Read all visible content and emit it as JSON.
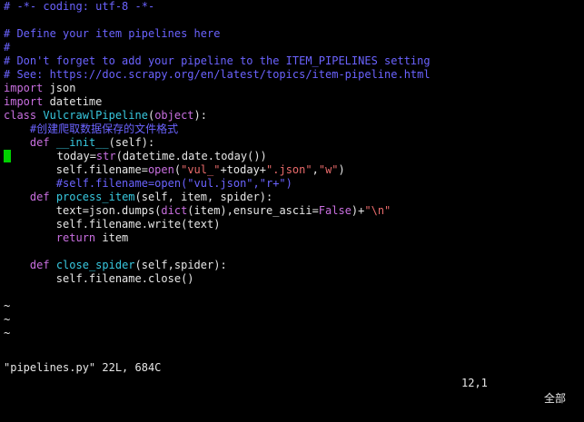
{
  "editor": {
    "lines": [
      [
        {
          "t": "# -*- coding: utf-8 -*-",
          "c": "comment"
        }
      ],
      [],
      [
        {
          "t": "# Define your item pipelines here",
          "c": "comment"
        }
      ],
      [
        {
          "t": "#",
          "c": "comment"
        }
      ],
      [
        {
          "t": "# Don't forget to add your pipeline to the ITEM_PIPELINES setting",
          "c": "comment"
        }
      ],
      [
        {
          "t": "# See: https://doc.scrapy.org/en/latest/topics/item-pipeline.html",
          "c": "comment"
        }
      ],
      [
        {
          "t": "import",
          "c": "keyword"
        },
        {
          "t": " json",
          "c": "plain"
        }
      ],
      [
        {
          "t": "import",
          "c": "keyword"
        },
        {
          "t": " datetime",
          "c": "plain"
        }
      ],
      [
        {
          "t": "class",
          "c": "keyword"
        },
        {
          "t": " ",
          "c": "plain"
        },
        {
          "t": "VulcrawlPipeline",
          "c": "class"
        },
        {
          "t": "(",
          "c": "plain"
        },
        {
          "t": "object",
          "c": "builtin"
        },
        {
          "t": "):",
          "c": "plain"
        }
      ],
      [
        {
          "t": "    #创建爬取数据保存的文件格式",
          "c": "comment"
        }
      ],
      [
        {
          "t": "    ",
          "c": "plain"
        },
        {
          "t": "def",
          "c": "keyword"
        },
        {
          "t": " ",
          "c": "plain"
        },
        {
          "t": "__init__",
          "c": "funcname"
        },
        {
          "t": "(self):",
          "c": "plain"
        }
      ],
      [
        {
          "t": "CURSOR",
          "c": "cursor"
        },
        {
          "t": "       today=",
          "c": "plain"
        },
        {
          "t": "str",
          "c": "builtin"
        },
        {
          "t": "(datetime.date.today())",
          "c": "plain"
        }
      ],
      [
        {
          "t": "        self.filename=",
          "c": "plain"
        },
        {
          "t": "open",
          "c": "builtin"
        },
        {
          "t": "(",
          "c": "plain"
        },
        {
          "t": "\"vul_\"",
          "c": "string"
        },
        {
          "t": "+today+",
          "c": "plain"
        },
        {
          "t": "\".json\"",
          "c": "string"
        },
        {
          "t": ",",
          "c": "plain"
        },
        {
          "t": "\"w\"",
          "c": "string"
        },
        {
          "t": ")",
          "c": "plain"
        }
      ],
      [
        {
          "t": "        #self.filename=open(\"vul.json\",\"r+\")",
          "c": "comment"
        }
      ],
      [
        {
          "t": "    ",
          "c": "plain"
        },
        {
          "t": "def",
          "c": "keyword"
        },
        {
          "t": " ",
          "c": "plain"
        },
        {
          "t": "process_item",
          "c": "funcname"
        },
        {
          "t": "(self, item, spider):",
          "c": "plain"
        }
      ],
      [
        {
          "t": "        text=json.dumps(",
          "c": "plain"
        },
        {
          "t": "dict",
          "c": "builtin"
        },
        {
          "t": "(item),ensure_ascii=",
          "c": "plain"
        },
        {
          "t": "False",
          "c": "builtin"
        },
        {
          "t": ")+",
          "c": "plain"
        },
        {
          "t": "\"\\n\"",
          "c": "string"
        }
      ],
      [
        {
          "t": "        self.filename.write(text)",
          "c": "plain"
        }
      ],
      [
        {
          "t": "        ",
          "c": "plain"
        },
        {
          "t": "return",
          "c": "keyword"
        },
        {
          "t": " item",
          "c": "plain"
        }
      ],
      [],
      [
        {
          "t": "    ",
          "c": "plain"
        },
        {
          "t": "def",
          "c": "keyword"
        },
        {
          "t": " ",
          "c": "plain"
        },
        {
          "t": "close_spider",
          "c": "funcname"
        },
        {
          "t": "(self,spider):",
          "c": "plain"
        }
      ],
      [
        {
          "t": "        self.filename.close()",
          "c": "plain"
        }
      ],
      [],
      [
        {
          "t": "~",
          "c": "tilde"
        }
      ],
      [
        {
          "t": "~",
          "c": "tilde"
        }
      ],
      [
        {
          "t": "~",
          "c": "tilde"
        }
      ]
    ]
  },
  "status": {
    "file": "\"pipelines.py\" 22L, 684C",
    "position": "12,1",
    "scroll": "全部"
  },
  "colors": {
    "background": "#000000",
    "comment": "#6b63ff",
    "keyword": "#c96fe0",
    "string": "#ea6b6b",
    "function": "#38c9e0",
    "text": "#e6e6e6",
    "cursor": "#00d000"
  }
}
